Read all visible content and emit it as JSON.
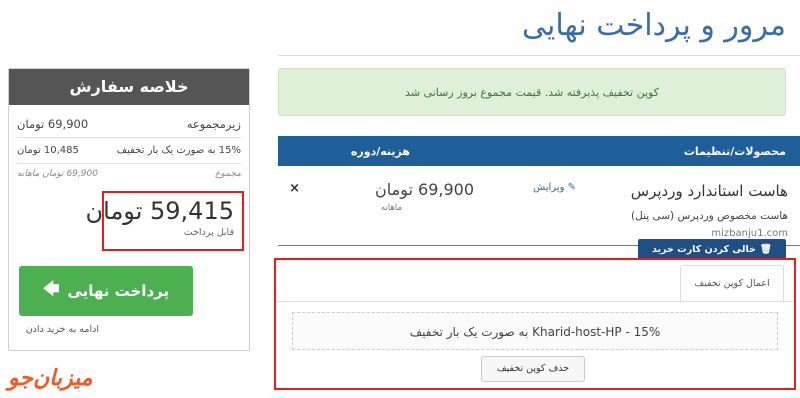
{
  "page": {
    "title": "مرور و پرداخت نهایی"
  },
  "summary": {
    "header": "خلاصه سفارش",
    "subtotal_label": "زیرمجموعه",
    "subtotal_value": "69,900 تومان",
    "discount_label": "15% به صورت یک بار تخفیف",
    "discount_value": "10,485 تومان",
    "recurring_label": "مجموع",
    "recurring_value": "69,900 تومان ماهانه",
    "total_amount": "59,415 تومان",
    "total_label": "قابل پرداخت",
    "checkout_label": "پرداخت نهایی",
    "continue_label": "ادامه به خرید دادن"
  },
  "alert": {
    "text": "کوپن تخفیف پذیرفته شد. قیمت مجموع بروز رسانی شد"
  },
  "cart": {
    "col_products": "محصولات/تنظیمات",
    "col_price": "هزینه/دوره",
    "items": [
      {
        "name": "هاست استاندارد وردپرس",
        "edit": "ویرایش",
        "description": "هاست مخصوص وردپرس (سی پنل)",
        "domain": "mizbanju1.com",
        "price": "69,900 تومان",
        "cycle": "ماهانه",
        "remove": "×"
      }
    ],
    "empty_cart": "خالی کردن کارت خرید"
  },
  "coupon": {
    "tab_label": "اعمال کوپن تخفیف",
    "applied_text": "Kharid-host-HP - 15% به صورت یک بار تخفیف",
    "remove_label": "حذف کوپن تخفیف"
  },
  "brand": {
    "logo_text": "میزبان‌جو"
  },
  "icons": {
    "edit": "pencil-icon",
    "arrow": "arrow-left-icon",
    "trash": "trash-icon"
  },
  "colors": {
    "primary": "#1e5f99",
    "success": "#4caf50",
    "highlight": "#e51e1e",
    "logo": "#f05a28"
  }
}
